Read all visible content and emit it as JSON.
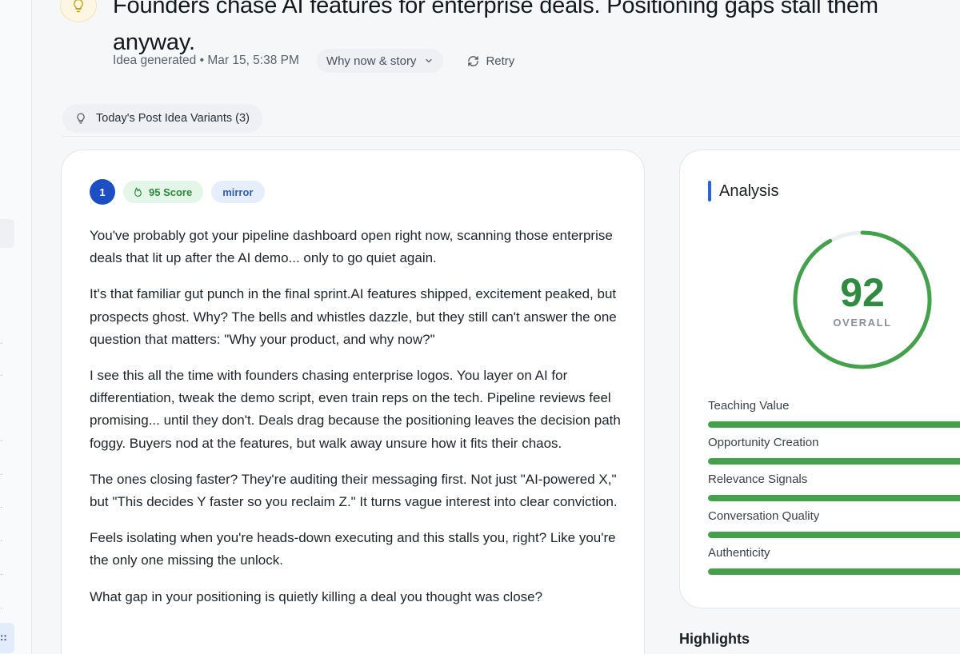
{
  "header": {
    "title": "Founders chase AI features for enterprise deals. Positioning gaps stall them anyway.",
    "meta": "Idea generated • Mar 15, 5:38 PM",
    "why_now_label": "Why now & story",
    "retry_label": "Retry"
  },
  "variants": {
    "label": "Today's Post Idea Variants (3)"
  },
  "post": {
    "number": "1",
    "score_label": "95 Score",
    "tag": "mirror",
    "paragraphs": [
      "You've probably got your pipeline dashboard open right now, scanning those enterprise deals that lit up after the AI demo... only to go quiet again.",
      "It's that familiar gut punch in the final sprint.AI features shipped, excitement peaked, but prospects ghost. Why? The bells and whistles dazzle, but they still can't answer the one question that matters: \"Why your product, and why now?\"",
      "I see this all the time with founders chasing enterprise logos. You layer on AI for differentiation, tweak the demo script, even train reps on the tech. Pipeline reviews feel promising... until they don't. Deals drag because the positioning leaves the decision path foggy. Buyers nod at the features, but walk away unsure how it fits their chaos.",
      "The ones closing faster? They're auditing their messaging first. Not just \"AI-powered X,\" but \"This decides Y faster so you reclaim Z.\" It turns vague interest into clear conviction.",
      "Feels isolating when you're heads-down executing and this stalls you, right? Like you're the only one missing the unlock.",
      "What gap in your positioning is quietly killing a deal you thought was close?"
    ]
  },
  "analysis": {
    "title": "Analysis",
    "overall_score": "92",
    "overall_fraction": 0.92,
    "overall_label": "OVERALL",
    "score_color": "#43a04b",
    "metrics": [
      {
        "label": "Teaching Value",
        "level": 1.0
      },
      {
        "label": "Opportunity Creation",
        "level": 1.0
      },
      {
        "label": "Relevance Signals",
        "level": 1.0
      },
      {
        "label": "Conversation Quality",
        "level": 1.0
      },
      {
        "label": "Authenticity",
        "level": 1.0
      }
    ]
  },
  "highlights": {
    "title": "Highlights"
  }
}
